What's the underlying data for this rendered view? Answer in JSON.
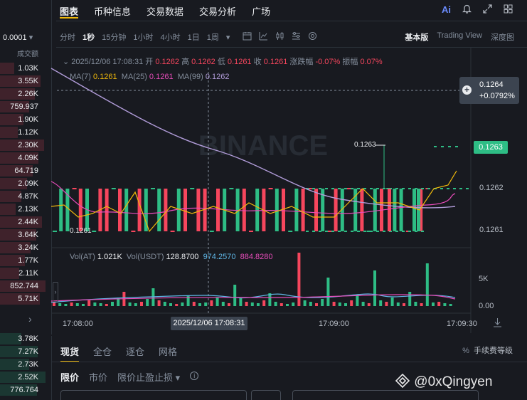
{
  "left_panel": {
    "tick_size": "0.0001",
    "header": "成交额",
    "sell_values": [
      "1.03K",
      "3.55K",
      "2.26K",
      "759.937",
      "1.90K",
      "1.12K",
      "2.30K",
      "4.09K",
      "64.719",
      "2.09K",
      "4.87K",
      "2.13K",
      "2.44K",
      "3.64K",
      "3.24K",
      "1.77K",
      "2.11K",
      "852.744",
      "5.71K"
    ],
    "buy_values": [
      "3.78K",
      "7.27K",
      "2.73K",
      "2.52K",
      "776.764"
    ],
    "expand_icon": "chevron-right-icon",
    "colors": {
      "sell": "#f6465d",
      "buy": "#2ebd85"
    }
  },
  "header": {
    "tabs": [
      "图表",
      "币种信息",
      "交易数据",
      "交易分析",
      "广场"
    ],
    "active_tab": "图表",
    "icons": [
      "ai-icon",
      "bell-icon",
      "expand-icon",
      "grid-icon"
    ],
    "ai_label": "Ai"
  },
  "toolbar": {
    "intervals": [
      "分时",
      "1秒",
      "15分钟",
      "1小时",
      "4小时",
      "1日",
      "1周"
    ],
    "active_interval": "1秒",
    "tool_icons": [
      "calendar-icon",
      "line-chart-icon",
      "candle-icon",
      "settings-icon",
      "layers-icon"
    ],
    "views": [
      "基本版",
      "Trading View",
      "深度图"
    ],
    "active_view": "基本版"
  },
  "ohlc": {
    "datetime": "2025/12/06 17:08:31",
    "open_label": "开",
    "open": "0.1262",
    "high_label": "高",
    "high": "0.1262",
    "low_label": "低",
    "low": "0.1261",
    "close_label": "收",
    "close": "0.1261",
    "change_label": "涨跌幅",
    "change": "-0.07%",
    "amp_label": "振幅",
    "amp": "0.07%"
  },
  "ma": {
    "ma7_label": "MA(7)",
    "ma7": "0.1261",
    "ma25_label": "MA(25)",
    "ma25": "0.1261",
    "ma99_label": "MA(99)",
    "ma99": "0.1262"
  },
  "price_axis": {
    "labels": [
      "0.1262",
      "0.1261"
    ],
    "crosshair_price": "0.1264",
    "crosshair_change": "+0.0792%",
    "last_price": "0.1263",
    "high_marker": "0.1263",
    "low_marker": "0.1261"
  },
  "volume": {
    "vol_label": "Vol(AT)",
    "vol": "1.021K",
    "vol_usdt_label": "Vol(USDT)",
    "vol_usdt": "128.8700",
    "ma1": "974.2570",
    "ma2": "884.8280",
    "axis": [
      "5K",
      "0.00"
    ]
  },
  "time_axis": {
    "labels": [
      "17:08:00",
      "17:09:00",
      "17:09:30"
    ],
    "crosshair_time": "2025/12/06 17:08:31"
  },
  "watermark_brand": "BINANCE",
  "bottom": {
    "tabs": [
      "现货",
      "全仓",
      "逐仓",
      "网格"
    ],
    "active_tab": "现货",
    "fee_label": "手续费等级",
    "order_types": [
      "限价",
      "市价",
      "限价止盈止损"
    ],
    "active_order": "限价"
  },
  "watermark": "@0xQingyen",
  "colors": {
    "up": "#2ebd85",
    "down": "#f6465d",
    "ma7": "#f0b90b",
    "ma25": "#e84cba",
    "ma99": "#b19cd9",
    "bg": "#181a20"
  }
}
